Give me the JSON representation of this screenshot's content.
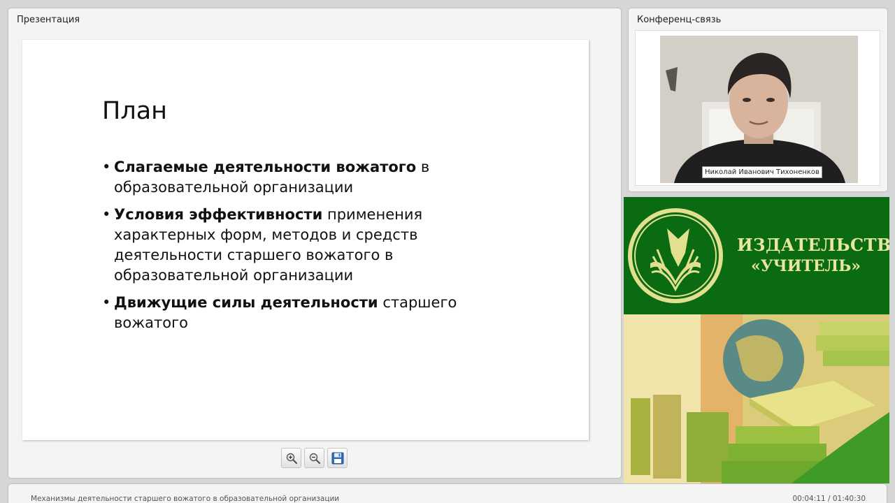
{
  "presentation": {
    "panel_title": "Презентация",
    "slide": {
      "heading": "План",
      "bullets": [
        {
          "bold": "Слагаемые деятельности вожатого",
          "text": " в образовательной организации"
        },
        {
          "bold": "Условия эффективности",
          "text": " применения характерных форм, методов и средств деятельности старшего вожатого в образовательной организации"
        },
        {
          "bold": "Движущие силы деятельности",
          "text": " старшего вожатого"
        }
      ]
    },
    "toolbar": {
      "zoom_in_icon": "zoom-in-icon",
      "zoom_out_icon": "zoom-out-icon",
      "save_icon": "floppy-disk-icon"
    }
  },
  "conference": {
    "panel_title": "Конференц-связь",
    "speaker_name": "Николай Иванович Тихоненков"
  },
  "ad": {
    "brand_line1": "ИЗДАТЕЛЬСТВО",
    "brand_line2": "«УЧИТЕЛЬ»",
    "colors": {
      "green": "#0b6b12",
      "gold": "#e9e6a0"
    }
  },
  "footer": {
    "title": "Механизмы деятельности старшего вожатого в образовательной организации",
    "time": "00:04:11 / 01:40:30"
  }
}
